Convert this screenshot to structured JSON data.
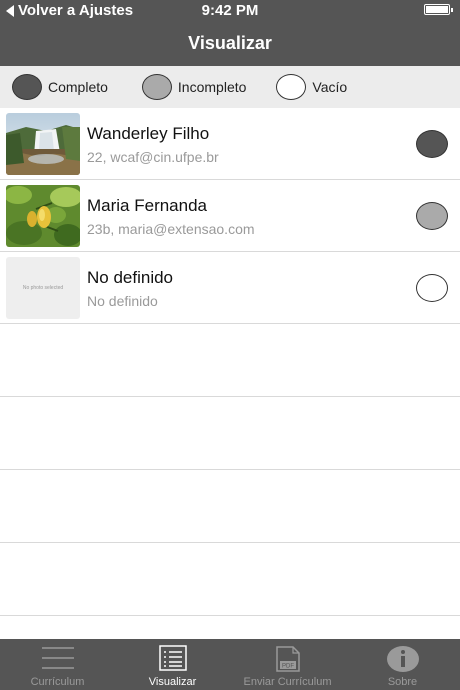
{
  "status_bar": {
    "back_label": "Volver a Ajustes",
    "time": "9:42 PM"
  },
  "nav": {
    "title": "Visualizar"
  },
  "legend": [
    {
      "label": "Completo",
      "color": "#555555"
    },
    {
      "label": "Incompleto",
      "color": "#aaaaaa"
    },
    {
      "label": "Vacío",
      "color": "#ffffff"
    }
  ],
  "entries": [
    {
      "name": "Wanderley Filho",
      "subtitle": "22, wcaf@cin.ufpe.br",
      "status_color": "#555555",
      "photo": "waterfall"
    },
    {
      "name": "Maria Fernanda",
      "subtitle": "23b, maria@extensao.com",
      "status_color": "#aaaaaa",
      "photo": "fruit-tree"
    },
    {
      "name": "No definido",
      "subtitle": "No definido",
      "status_color": "#ffffff",
      "photo_placeholder": "No photo selected"
    }
  ],
  "tabs": [
    {
      "label": "Currículum",
      "icon": "menu-lines-icon",
      "active": false
    },
    {
      "label": "Visualizar",
      "icon": "list-view-icon",
      "active": true
    },
    {
      "label": "Enviar Currículum",
      "icon": "pdf-document-icon",
      "active": false
    },
    {
      "label": "Sobre",
      "icon": "info-icon",
      "active": false
    }
  ]
}
